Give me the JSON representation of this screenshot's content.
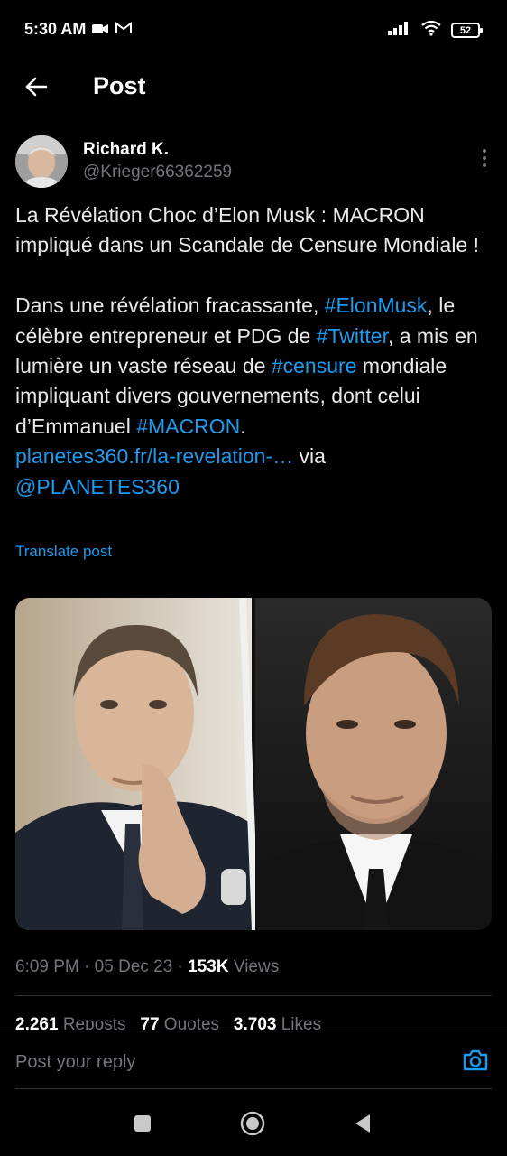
{
  "status_bar": {
    "time": "5:30 AM",
    "battery": "52"
  },
  "header": {
    "title": "Post"
  },
  "author": {
    "name": "Richard K.",
    "handle": "@Krieger66362259"
  },
  "tweet": {
    "para1": "La Révélation Choc d’Elon Musk : MACRON impliqué dans un Scandale de Censure Mondiale !",
    "p2_t1": "Dans une révélation fracassante, ",
    "p2_h1": "#ElonMusk",
    "p2_t2": ", le célèbre entrepreneur et PDG de ",
    "p2_h2": "#Twitter",
    "p2_t3": ", a mis en lumière un vaste réseau de ",
    "p2_h3": "#censure",
    "p2_t4": " mondiale impliquant divers gouvernements, dont celui d’Emmanuel ",
    "p2_h4": "#MACRON",
    "p2_t5": ".",
    "link": "planetes360.fr/la-revelation-…",
    "via": " via",
    "mention": "@PLANETES360"
  },
  "translate_label": "Translate post",
  "meta": {
    "time": "6:09 PM",
    "sep1": " · ",
    "date": "05 Dec 23",
    "sep2": " · ",
    "views_count": "153K",
    "views_label": " Views"
  },
  "stats": {
    "reposts_count": "2,261",
    "reposts_label": " Reposts",
    "quotes_count": "77",
    "quotes_label": " Quotes",
    "likes_count": "3,703",
    "likes_label": " Likes"
  },
  "reply": {
    "placeholder": "Post your reply"
  },
  "colors": {
    "background": "#000000",
    "link": "#1d9bf0",
    "secondary_text": "#71767b"
  }
}
